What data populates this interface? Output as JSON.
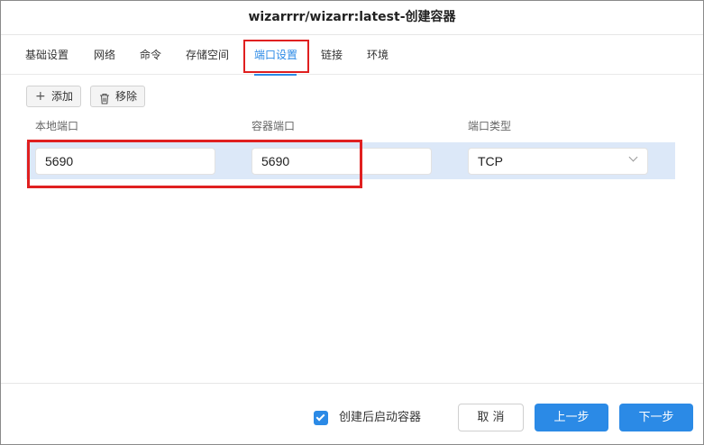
{
  "window": {
    "title": "wizarrrr/wizarr:latest-创建容器"
  },
  "tabs": [
    {
      "label": "基础设置",
      "active": false
    },
    {
      "label": "网络",
      "active": false
    },
    {
      "label": "命令",
      "active": false
    },
    {
      "label": "存储空间",
      "active": false
    },
    {
      "label": "端口设置",
      "active": true
    },
    {
      "label": "链接",
      "active": false
    },
    {
      "label": "环境",
      "active": false
    }
  ],
  "toolbar": {
    "add_icon": "+",
    "add_label": "添加",
    "remove_icon": "trash-icon",
    "remove_label": "移除"
  },
  "table": {
    "columns": [
      "本地端口",
      "容器端口",
      "端口类型"
    ],
    "rows": [
      {
        "local_port": "5690",
        "container_port": "5690",
        "port_type": "TCP"
      }
    ]
  },
  "footer": {
    "start_after_create_checked": true,
    "start_after_create_label": "创建后启动容器",
    "cancel_label": "取 消",
    "prev_label": "上一步",
    "next_label": "下一步"
  },
  "colors": {
    "accent": "#2b8ae6",
    "highlight": "#e02020",
    "row_bg": "#dce8f8"
  }
}
